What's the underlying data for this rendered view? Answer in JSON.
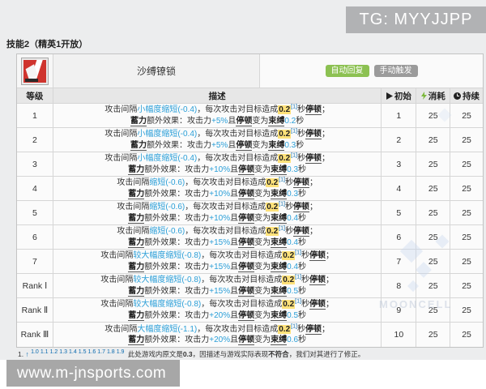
{
  "watermarks": {
    "tg": "TG: MYYJJPP",
    "site": "www.m-jnsports.com",
    "faint": "MOONCELL"
  },
  "section_title": "技能2（精英1开放）",
  "skill": {
    "name": "沙缚镣锁",
    "icon": "red-blade-skill-icon",
    "badges": [
      {
        "label": "自动回复",
        "color": "#8cc152"
      },
      {
        "label": "手动触发",
        "color": "#9b9b9b"
      }
    ]
  },
  "table": {
    "headers": {
      "level": "等级",
      "desc": "描述",
      "init": "初始",
      "cost": "消耗",
      "duration": "持续"
    },
    "header_icons": {
      "init": "play-icon",
      "cost": "lightning-icon",
      "duration": "clock-icon"
    },
    "colors": {
      "accent_blue": "#2b9fd8",
      "highlight_yellow": "#ffe27a",
      "badge_green": "#8cc152",
      "badge_gray": "#9b9b9b"
    },
    "desc_parts": {
      "prefix": "攻击间隔",
      "mid": "，每次攻击对目标造成",
      "hit_value": "0.2",
      "ref": "[1]",
      "sec": "秒",
      "stun": "停顿",
      "semi": "；",
      "charge": "蓄力",
      "extra": "额外效果：攻击力",
      "and": "且",
      "become": "变为",
      "bind_word": "束缚",
      "sec2": "秒"
    },
    "rows": [
      {
        "level": "1",
        "interval": "小幅度缩短(-0.4)",
        "atk": "+5%",
        "bind": "0.2",
        "init": "1",
        "cost": "25",
        "duration": "25"
      },
      {
        "level": "2",
        "interval": "小幅度缩短(-0.4)",
        "atk": "+5%",
        "bind": "0.3",
        "init": "2",
        "cost": "25",
        "duration": "25"
      },
      {
        "level": "3",
        "interval": "小幅度缩短(-0.4)",
        "atk": "+10%",
        "bind": "0.3",
        "init": "3",
        "cost": "25",
        "duration": "25"
      },
      {
        "level": "4",
        "interval": "缩短(-0.6)",
        "atk": "+10%",
        "bind": "0.3",
        "init": "4",
        "cost": "25",
        "duration": "25"
      },
      {
        "level": "5",
        "interval": "缩短(-0.6)",
        "atk": "+10%",
        "bind": "0.4",
        "init": "5",
        "cost": "25",
        "duration": "25"
      },
      {
        "level": "6",
        "interval": "缩短(-0.6)",
        "atk": "+15%",
        "bind": "0.4",
        "init": "6",
        "cost": "25",
        "duration": "25"
      },
      {
        "level": "7",
        "interval": "较大幅度缩短(-0.8)",
        "atk": "+15%",
        "bind": "0.4",
        "init": "7",
        "cost": "25",
        "duration": "25"
      },
      {
        "level": "Rank Ⅰ",
        "interval": "较大幅度缩短(-0.8)",
        "atk": "+15%",
        "bind": "0.5",
        "init": "8",
        "cost": "25",
        "duration": "25"
      },
      {
        "level": "Rank Ⅱ",
        "interval": "较大幅度缩短(-0.8)",
        "atk": "+20%",
        "bind": "0.5",
        "init": "9",
        "cost": "25",
        "duration": "25"
      },
      {
        "level": "Rank Ⅲ",
        "interval": "大幅度缩短(-1.1)",
        "atk": "+20%",
        "bind": "0.6",
        "init": "10",
        "cost": "25",
        "duration": "25"
      }
    ]
  },
  "footnote": {
    "index": "1.",
    "arrow": "↑",
    "links": [
      "1.0",
      "1.1",
      "1.2",
      "1.3",
      "1.4",
      "1.5",
      "1.6",
      "1.7",
      "1.8",
      "1.9"
    ],
    "text_pre": "此处游戏内原文是",
    "bold1": "0.3",
    "text_mid": "，因描述与游戏实际表现",
    "bold2": "不符合",
    "text_post": "，我们对其进行了修正。"
  }
}
